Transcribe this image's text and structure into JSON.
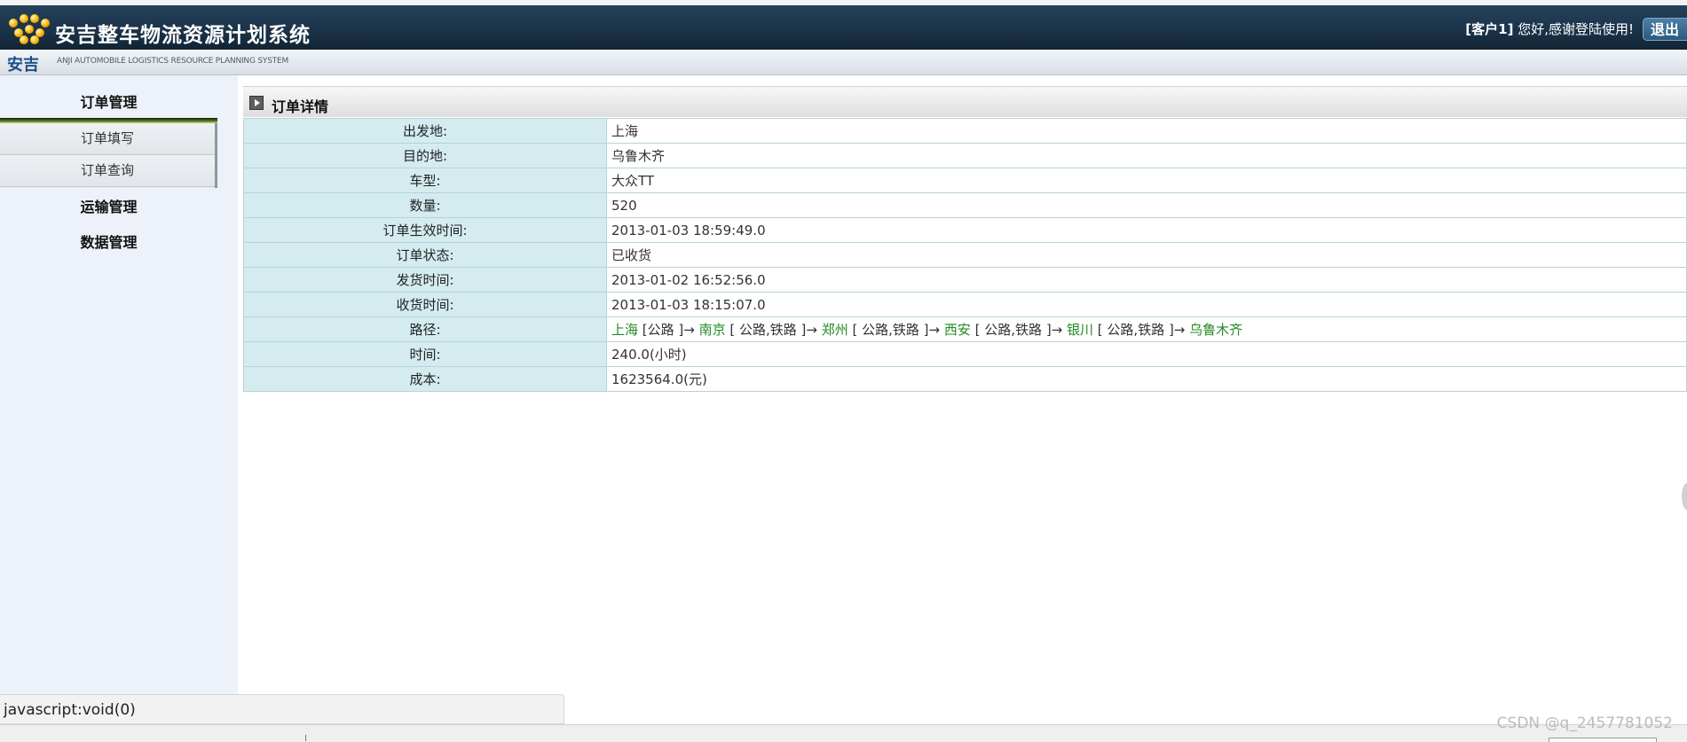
{
  "header": {
    "app_title": "安吉整车物流资源计划系统",
    "greeting_user": "[客户1]",
    "greeting_text": " 您好,感谢登陆使用!",
    "logout_label": "退出",
    "brand_cn": "安吉",
    "brand_tagline": "ANJI AUTOMOBILE LOGISTICS RESOURCE PLANNING SYSTEM"
  },
  "sidebar": {
    "groups": [
      {
        "label": "订单管理",
        "items": [
          {
            "label": "订单填写"
          },
          {
            "label": "订单查询"
          }
        ]
      },
      {
        "label": "运输管理"
      },
      {
        "label": "数据管理"
      }
    ]
  },
  "panel": {
    "title": "订单详情",
    "rows": [
      {
        "label": "出发地:",
        "value": "上海"
      },
      {
        "label": "目的地:",
        "value": "乌鲁木齐"
      },
      {
        "label": "车型:",
        "value": "大众TT"
      },
      {
        "label": "数量:",
        "value": "520"
      },
      {
        "label": "订单生效时间:",
        "value": "2013-01-03 18:59:49.0"
      },
      {
        "label": "订单状态:",
        "value": " 已收货"
      },
      {
        "label": "发货时间:",
        "value": "2013-01-02 16:52:56.0"
      },
      {
        "label": "收货时间:",
        "value": "2013-01-03 18:15:07.0"
      },
      {
        "label": "路径:"
      },
      {
        "label": "时间:",
        "value": "240.0(小时)"
      },
      {
        "label": "成本:",
        "value": "1623564.0(元)"
      }
    ],
    "route": [
      {
        "city": "上海",
        "mode": " [公路 ]→ "
      },
      {
        "city": "南京",
        "mode": " [ 公路,铁路 ]→ "
      },
      {
        "city": "郑州",
        "mode": " [ 公路,铁路 ]→ "
      },
      {
        "city": "西安",
        "mode": " [ 公路,铁路 ]→ "
      },
      {
        "city": "银川",
        "mode": " [ 公路,铁路 ]→ "
      },
      {
        "city": "乌鲁木齐",
        "mode": ""
      }
    ]
  },
  "statusbar": {
    "text": "javascript:void(0)"
  },
  "watermark": "CSDN @q_2457781052",
  "colors": {
    "header_bg": "#1b3349",
    "label_cell_bg": "#d4ecf0",
    "route_city": "#228b22",
    "sidebar_bg": "#edf1fa"
  }
}
